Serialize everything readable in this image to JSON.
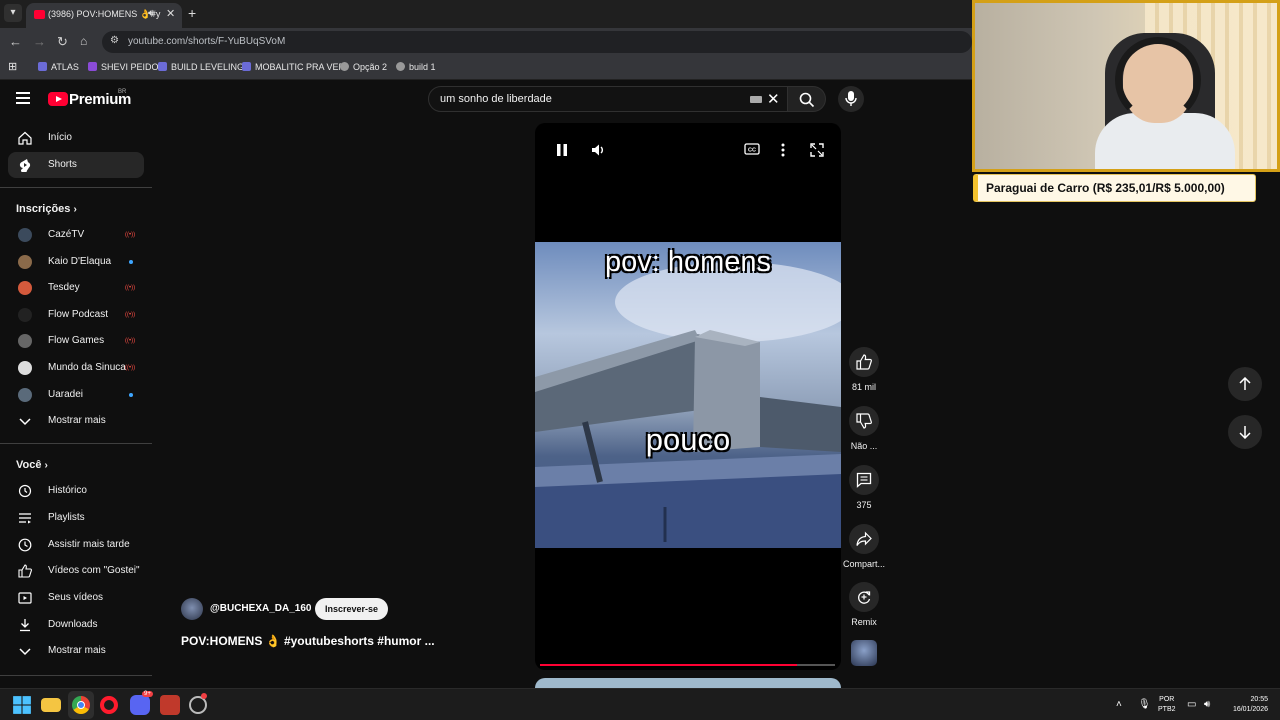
{
  "browser": {
    "tab_title": "(3986) POV:HOMENS 👌#y",
    "new_tab_symbol": "+",
    "url": "youtube.com/shorts/F-YuBUqSVoM",
    "bookmarks": [
      "ATLAS",
      "SHEVI PEIDO",
      "BUILD LEVELING",
      "MOBALITIC PRA VER",
      "Opção 2",
      "build 1"
    ]
  },
  "masthead": {
    "brand": "Premium",
    "region": "BR",
    "search_query": "um sonho de liberdade"
  },
  "sidebar": {
    "main": [
      {
        "label": "Início",
        "icon": "home-icon"
      },
      {
        "label": "Shorts",
        "icon": "shorts-icon"
      }
    ],
    "subscriptions_title": "Inscrições",
    "subscriptions": [
      {
        "label": "CazéTV",
        "status": "live",
        "color": "#3b4a5c"
      },
      {
        "label": "Kaio D'Elaqua",
        "status": "new",
        "color": "#8a6a4a"
      },
      {
        "label": "Tesdey",
        "status": "live",
        "color": "#d45a3c"
      },
      {
        "label": "Flow Podcast",
        "status": "live",
        "color": "#222222"
      },
      {
        "label": "Flow Games",
        "status": "live",
        "color": "#666666"
      },
      {
        "label": "Mundo da Sinuca",
        "status": "live",
        "color": "#dddddd"
      },
      {
        "label": "Uaradei",
        "status": "new",
        "color": "#5a6a7a"
      }
    ],
    "subscriptions_more": "Mostrar mais",
    "you_title": "Você",
    "you_items": [
      {
        "label": "Histórico",
        "icon": "history-icon"
      },
      {
        "label": "Playlists",
        "icon": "playlists-icon"
      },
      {
        "label": "Assistir mais tarde",
        "icon": "watch-later-icon"
      },
      {
        "label": "Vídeos com \"Gostei\"",
        "icon": "liked-icon"
      },
      {
        "label": "Seus vídeos",
        "icon": "your-videos-icon"
      },
      {
        "label": "Downloads",
        "icon": "downloads-icon"
      },
      {
        "label": "Mostrar mais",
        "icon": "chevron-down-icon"
      }
    ]
  },
  "short": {
    "caption_top": "pov: homens",
    "caption_mid": "pouco",
    "progress": 0.87,
    "channel_handle": "@BUCHEXA_DA_160",
    "subscribe_label": "Inscrever-se",
    "title": "POV:HOMENS 👌 #youtubeshorts #humor ..."
  },
  "actions": {
    "likes": "81 mil",
    "dislike": "Não ...",
    "comments": "375",
    "share": "Compart...",
    "remix": "Remix"
  },
  "overlay": {
    "goal": "Paraguai de Carro (R$ 235,01/R$ 5.000,00)"
  },
  "taskbar": {
    "lang_top": "POR",
    "lang_bottom": "PTB2",
    "time": "20:55",
    "date": "16/01/2026",
    "discord_badge": "9+"
  },
  "colors": {
    "accent": "#ff0033",
    "goal_border": "#f2c12e",
    "webcam_border": "#d4a017"
  }
}
